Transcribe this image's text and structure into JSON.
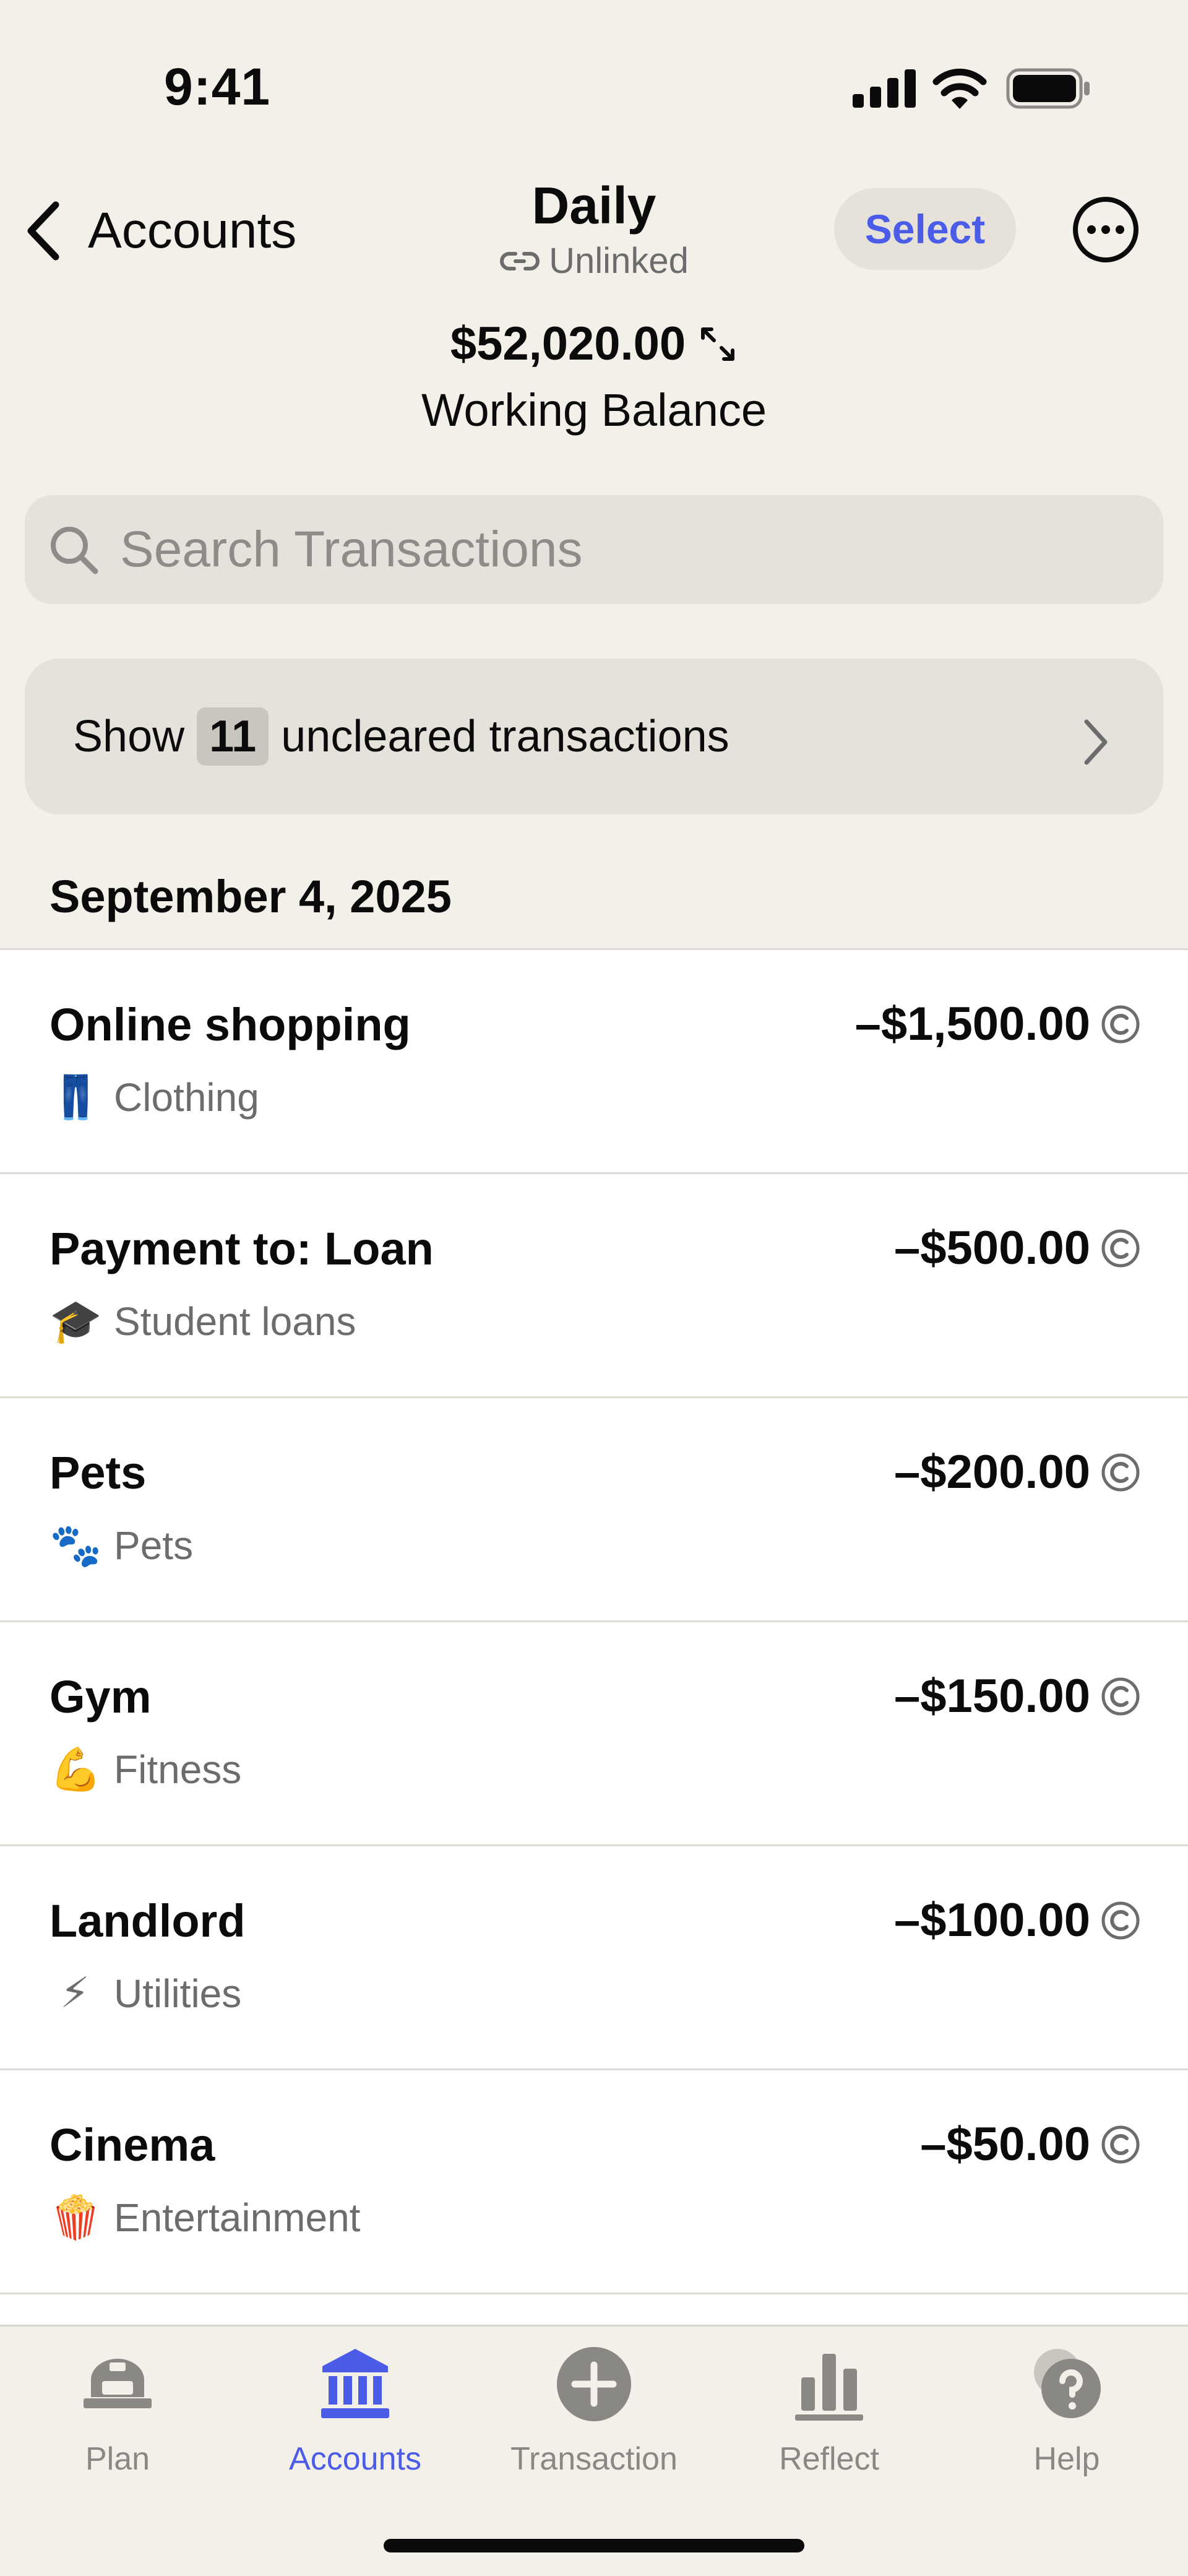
{
  "status_bar": {
    "time": "9:41"
  },
  "header": {
    "back_label": "Accounts",
    "title": "Daily",
    "subtitle": "Unlinked",
    "select_label": "Select"
  },
  "balance": {
    "amount": "$52,020.00",
    "label": "Working Balance"
  },
  "search": {
    "placeholder": "Search Transactions"
  },
  "uncleared": {
    "prefix": "Show",
    "count": "11",
    "suffix": "uncleared transactions"
  },
  "date_header": "September 4, 2025",
  "transactions": [
    {
      "payee": "Online shopping",
      "amount": "–$1,500.00",
      "category": "Clothing",
      "emoji": "👖"
    },
    {
      "payee": "Payment to: Loan",
      "amount": "–$500.00",
      "category": "Student loans",
      "emoji": "🎓"
    },
    {
      "payee": "Pets",
      "amount": "–$200.00",
      "category": "Pets",
      "emoji": "🐾"
    },
    {
      "payee": "Gym",
      "amount": "–$150.00",
      "category": "Fitness",
      "emoji": "💪"
    },
    {
      "payee": "Landlord",
      "amount": "–$100.00",
      "category": "Utilities",
      "emoji": "⚡"
    },
    {
      "payee": "Cinema",
      "amount": "–$50.00",
      "category": "Entertainment",
      "emoji": "🍿"
    }
  ],
  "tabs": [
    {
      "label": "Plan",
      "icon": "plan-icon"
    },
    {
      "label": "Accounts",
      "icon": "bank-icon"
    },
    {
      "label": "Transaction",
      "icon": "plus-circle-icon"
    },
    {
      "label": "Reflect",
      "icon": "bar-chart-icon"
    },
    {
      "label": "Help",
      "icon": "help-bubble-icon"
    }
  ],
  "colors": {
    "background": "#f3f0e9",
    "accent": "#4b5ce8",
    "secondary_text": "#6c6c6c",
    "pill": "#e5e2dc"
  }
}
